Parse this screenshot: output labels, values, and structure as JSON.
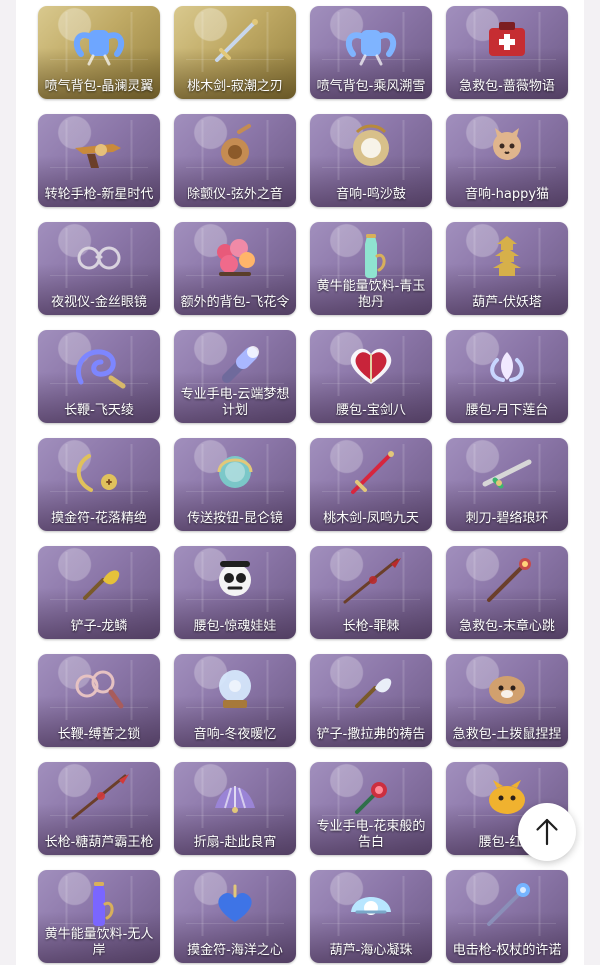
{
  "items": [
    {
      "name": "喷气背包-晶澜灵翼",
      "icon": "jetpack-icon",
      "style": "gold",
      "color": "#6ea6ff"
    },
    {
      "name": "桃木剑-寂潮之刃",
      "icon": "sword-icon",
      "style": "gold",
      "color": "#c8d6ea"
    },
    {
      "name": "喷气背包-乘风溯雪",
      "icon": "jetpack-icon",
      "style": "purple",
      "color": "#7fb4ff"
    },
    {
      "name": "急救包-蔷薇物语",
      "icon": "medkit-icon",
      "style": "purple",
      "color": "#c62d32"
    },
    {
      "name": "转轮手枪-新星时代",
      "icon": "revolver-icon",
      "style": "purple",
      "color": "#c98a3b"
    },
    {
      "name": "除颤仪-弦外之音",
      "icon": "defibrillator-icon",
      "style": "purple",
      "color": "#c58c52"
    },
    {
      "name": "音响-鸣沙鼓",
      "icon": "drum-icon",
      "style": "purple",
      "color": "#d8c08a"
    },
    {
      "name": "音响-happy猫",
      "icon": "cat-speaker-icon",
      "style": "purple",
      "color": "#e0b58d"
    },
    {
      "name": "夜视仪-金丝眼镜",
      "icon": "glasses-icon",
      "style": "purple",
      "color": "#d9d3df"
    },
    {
      "name": "额外的背包-飞花令",
      "icon": "flower-backpack-icon",
      "style": "purple",
      "color": "#e85a7a"
    },
    {
      "name": "黄牛能量饮料-青玉抱丹",
      "icon": "energy-drink-icon",
      "style": "purple",
      "color": "#8fe4d0"
    },
    {
      "name": "葫芦-伏妖塔",
      "icon": "pagoda-icon",
      "style": "purple",
      "color": "#d6b04a"
    },
    {
      "name": "长鞭-飞天绫",
      "icon": "whip-icon",
      "style": "purple",
      "color": "#7d86ff"
    },
    {
      "name": "专业手电-云端梦想计划",
      "icon": "flashlight-icon",
      "style": "purple",
      "color": "#a9b7ff"
    },
    {
      "name": "腰包-宝剑八",
      "icon": "heart-pouch-icon",
      "style": "purple",
      "color": "#e3d2a4"
    },
    {
      "name": "腰包-月下莲台",
      "icon": "lotus-pouch-icon",
      "style": "purple",
      "color": "#f1e9ff"
    },
    {
      "name": "摸金符-花落精绝",
      "icon": "amulet-icon",
      "style": "purple",
      "color": "#e0c15c"
    },
    {
      "name": "传送按钮-昆仑镜",
      "icon": "mirror-icon",
      "style": "purple",
      "color": "#7ad0cc"
    },
    {
      "name": "桃木剑-凤鸣九天",
      "icon": "sword-icon",
      "style": "purple",
      "color": "#d7263e"
    },
    {
      "name": "刺刀-碧络琅环",
      "icon": "bayonet-icon",
      "style": "purple",
      "color": "#d7d7d7"
    },
    {
      "name": "铲子-龙鳞",
      "icon": "shovel-icon",
      "style": "purple",
      "color": "#e5c13a"
    },
    {
      "name": "腰包-惊魂娃娃",
      "icon": "skull-doll-icon",
      "style": "purple",
      "color": "#f4f4f4"
    },
    {
      "name": "长枪-罪棘",
      "icon": "spear-icon",
      "style": "purple",
      "color": "#b92a2a"
    },
    {
      "name": "急救包-末章心跳",
      "icon": "scepter-icon",
      "style": "purple",
      "color": "#c64b4b"
    },
    {
      "name": "长鞭-缚誓之锁",
      "icon": "chain-whip-icon",
      "style": "purple",
      "color": "#e6c2c2"
    },
    {
      "name": "音响-冬夜暖忆",
      "icon": "snow-globe-icon",
      "style": "purple",
      "color": "#d8ecff"
    },
    {
      "name": "铲子-撒拉弗的祷告",
      "icon": "shovel-icon",
      "style": "purple",
      "color": "#e9eef8"
    },
    {
      "name": "急救包-土拨鼠捏捏",
      "icon": "groundhog-icon",
      "style": "purple",
      "color": "#d1a06e"
    },
    {
      "name": "长枪-糖葫芦霸王枪",
      "icon": "spear-icon",
      "style": "purple",
      "color": "#d23a3a"
    },
    {
      "name": "折扇-赴此良宵",
      "icon": "fan-icon",
      "style": "purple",
      "color": "#9a84d6"
    },
    {
      "name": "专业手电-花束般的告白",
      "icon": "rose-flashlight-icon",
      "style": "purple",
      "color": "#cc2f3f"
    },
    {
      "name": "腰包-红运",
      "icon": "cat-pouch-icon",
      "style": "purple",
      "color": "#f0b22f"
    },
    {
      "name": "黄牛能量饮料-无人岸",
      "icon": "energy-drink-icon",
      "style": "purple",
      "color": "#7a66ff"
    },
    {
      "name": "摸金符-海洋之心",
      "icon": "heart-amulet-icon",
      "style": "purple",
      "color": "#3e74e6"
    },
    {
      "name": "葫芦-海心凝珠",
      "icon": "shell-icon",
      "style": "purple",
      "color": "#b8e6ff"
    },
    {
      "name": "电击枪-权杖的许诺",
      "icon": "taser-scepter-icon",
      "style": "purple",
      "color": "#75b4ff"
    }
  ],
  "scroll_top_button": {
    "icon": "arrow-up-icon",
    "aria_label": "返回顶部"
  }
}
